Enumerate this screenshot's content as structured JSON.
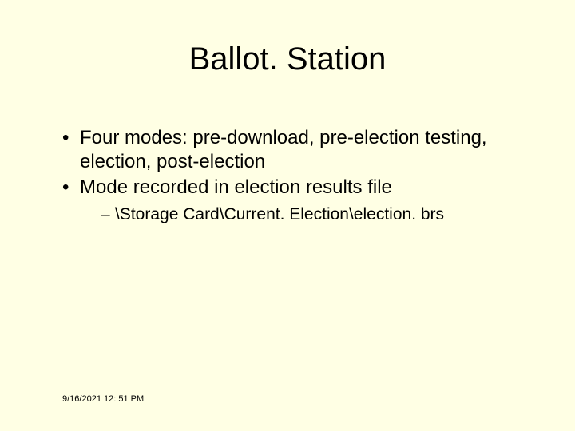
{
  "title": "Ballot. Station",
  "bullets": {
    "b1": "Four modes:  pre-download, pre-election testing, election, post-election",
    "b2": "Mode recorded in election results file",
    "b2_sub1": "\\Storage Card\\Current. Election\\election. brs"
  },
  "footer": {
    "datetime": "9/16/2021 12: 51 PM"
  }
}
